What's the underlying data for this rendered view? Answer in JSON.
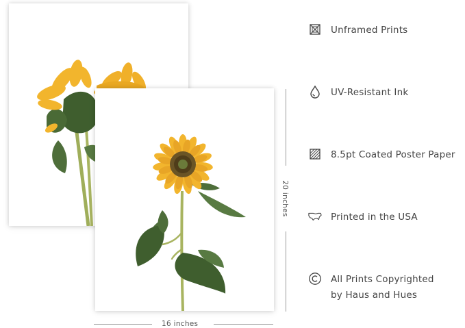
{
  "features": [
    {
      "icon": "unframed-icon",
      "lines": [
        "Unframed Prints"
      ]
    },
    {
      "icon": "ink-drop-icon",
      "lines": [
        "UV-Resistant Ink"
      ]
    },
    {
      "icon": "paper-icon",
      "lines": [
        "8.5pt Coated Poster Paper"
      ]
    },
    {
      "icon": "usa-map-icon",
      "lines": [
        "Printed in the USA"
      ]
    },
    {
      "icon": "copyright-icon",
      "lines": [
        "All Prints Copyrighted",
        "by Haus and Hues"
      ]
    }
  ],
  "dimensions": {
    "height_label": "20 inches",
    "width_label": "16 inches"
  },
  "colors": {
    "petal": "#f2b52d",
    "petal_dark": "#e09b1a",
    "center": "#5e4a22",
    "leaf": "#4e6e3a",
    "stem": "#a8b460",
    "text": "#444444",
    "rule": "#9a9a9a"
  }
}
